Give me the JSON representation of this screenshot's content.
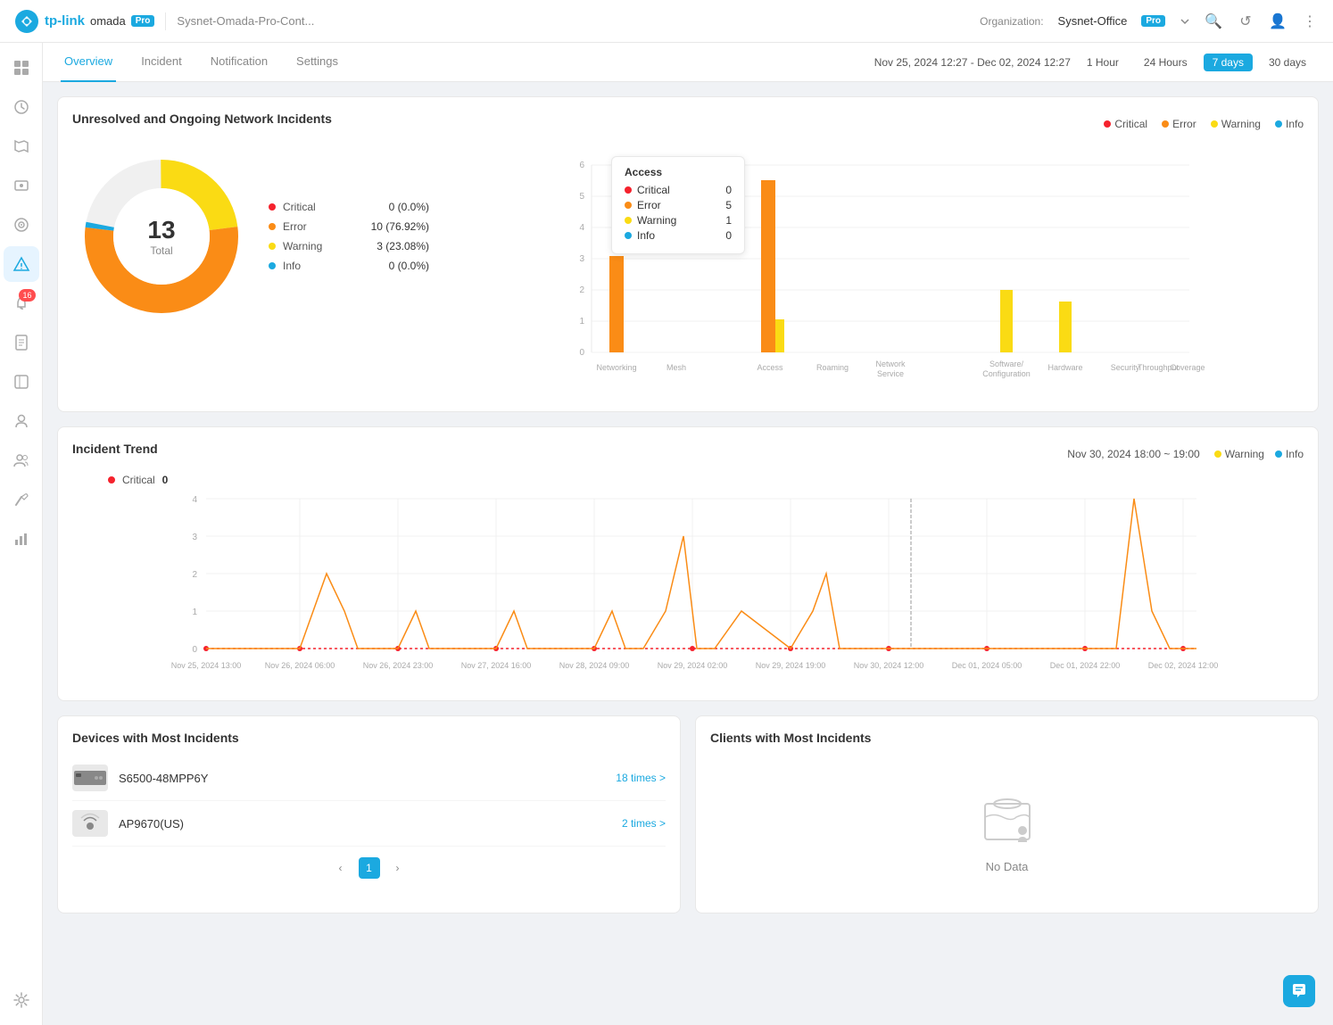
{
  "topbar": {
    "logo_tp": "tp-link",
    "logo_omada": "omada",
    "logo_pro": "Pro",
    "title": "Sysnet-Omada-Pro-Cont...",
    "org_label": "Organization:",
    "org_name": "Sysnet-Office",
    "org_pro": "Pro",
    "icons": [
      "search",
      "refresh",
      "user",
      "more"
    ]
  },
  "tabs": {
    "items": [
      "Overview",
      "Incident",
      "Notification",
      "Settings"
    ],
    "active": "Overview",
    "date_range": "Nov 25, 2024 12:27 - Dec 02, 2024 12:27",
    "time_filters": [
      "1 Hour",
      "24 Hours",
      "7 days",
      "30 days"
    ],
    "active_time": "7 days"
  },
  "sidebar": {
    "items": [
      {
        "name": "dashboard",
        "icon": "⊞",
        "active": false
      },
      {
        "name": "clock",
        "icon": "○",
        "active": false
      },
      {
        "name": "map",
        "icon": "◻",
        "active": false
      },
      {
        "name": "box",
        "icon": "⬜",
        "active": false
      },
      {
        "name": "target",
        "icon": "◎",
        "active": false
      },
      {
        "name": "incidents",
        "icon": "⚡",
        "active": true,
        "badge": null
      },
      {
        "name": "reports-badge",
        "icon": "📋",
        "active": false,
        "badge": "16"
      },
      {
        "name": "clipboard",
        "icon": "📄",
        "active": false
      },
      {
        "name": "briefcase",
        "icon": "💼",
        "active": false
      },
      {
        "name": "users",
        "icon": "👤",
        "active": false
      },
      {
        "name": "users2",
        "icon": "👥",
        "active": false
      },
      {
        "name": "tools",
        "icon": "🔧",
        "active": false
      },
      {
        "name": "chart",
        "icon": "📊",
        "active": false
      }
    ],
    "bottom": {
      "name": "settings",
      "icon": "⚙"
    }
  },
  "incidents_chart": {
    "title": "Unresolved and Ongoing Network Incidents",
    "legend": [
      {
        "name": "Critical",
        "color": "#f5222d"
      },
      {
        "name": "Error",
        "color": "#fa8c16"
      },
      {
        "name": "Warning",
        "color": "#fadb14"
      },
      {
        "name": "Info",
        "color": "#1ba9e0"
      }
    ],
    "donut": {
      "total": 13,
      "total_label": "Total",
      "segments": [
        {
          "name": "Critical",
          "value": 0,
          "pct": "0.0%",
          "color": "#f5222d",
          "angle": 0
        },
        {
          "name": "Error",
          "value": 10,
          "pct": "76.92%",
          "color": "#fa8c16",
          "angle": 277
        },
        {
          "name": "Warning",
          "value": 3,
          "pct": "23.08%",
          "color": "#fadb14",
          "angle": 83
        },
        {
          "name": "Info",
          "value": 0,
          "pct": "0.0%",
          "color": "#1ba9e0",
          "angle": 0
        }
      ],
      "stats": [
        {
          "name": "Critical",
          "value": "0 (0.0%)",
          "color": "#f5222d"
        },
        {
          "name": "Error",
          "value": "10 (76.92%)",
          "color": "#fa8c16"
        },
        {
          "name": "Warning",
          "value": "3 (23.08%)",
          "color": "#fadb14"
        },
        {
          "name": "Info",
          "value": "0 (0.0%)",
          "color": "#1ba9e0"
        }
      ]
    },
    "bar_chart": {
      "categories": [
        "Networking",
        "Mesh",
        "Access",
        "Roaming",
        "Network\nService",
        "Software/\nConfiguration",
        "Hardware",
        "Security",
        "Throughput",
        "Coverage"
      ],
      "y_max": 6,
      "y_ticks": [
        0,
        1,
        2,
        3,
        4,
        5,
        6
      ],
      "tooltip": {
        "title": "Access",
        "items": [
          {
            "name": "Critical",
            "value": 0,
            "color": "#f5222d"
          },
          {
            "name": "Error",
            "value": 5,
            "color": "#fa8c16"
          },
          {
            "name": "Warning",
            "value": 1,
            "color": "#fadb14"
          },
          {
            "name": "Info",
            "value": 0,
            "color": "#1ba9e0"
          }
        ]
      },
      "bars": [
        {
          "cat": "Networking",
          "error": 2.8,
          "warning": 0,
          "critical": 0
        },
        {
          "cat": "Mesh",
          "error": 0,
          "warning": 0,
          "critical": 0
        },
        {
          "cat": "Access",
          "error": 5,
          "warning": 1,
          "critical": 0
        },
        {
          "cat": "Roaming",
          "error": 0,
          "warning": 0,
          "critical": 0
        },
        {
          "cat": "Network Service",
          "error": 0,
          "warning": 0,
          "critical": 0
        },
        {
          "cat": "Software/Configuration",
          "error": 0,
          "warning": 2,
          "critical": 0
        },
        {
          "cat": "Hardware",
          "error": 0,
          "warning": 1.5,
          "critical": 0
        },
        {
          "cat": "Security",
          "error": 0,
          "warning": 0,
          "critical": 0
        },
        {
          "cat": "Throughput",
          "error": 0,
          "warning": 0,
          "critical": 0
        },
        {
          "cat": "Coverage",
          "error": 0,
          "warning": 0,
          "critical": 0
        }
      ]
    }
  },
  "trend_chart": {
    "title": "Incident Trend",
    "hover_time": "Nov 30, 2024 18:00 ~ 19:00",
    "legend": [
      {
        "name": "Warning",
        "color": "#fadb14"
      },
      {
        "name": "Info",
        "color": "#1ba9e0"
      }
    ],
    "hover_stats": [
      {
        "name": "Critical",
        "value": 0,
        "color": "#f5222d"
      }
    ],
    "x_labels": [
      "Nov 25, 2024 13:00",
      "Nov 26, 2024 06:00",
      "Nov 26, 2024 23:00",
      "Nov 27, 2024 16:00",
      "Nov 28, 2024 09:00",
      "Nov 29, 2024 02:00",
      "Nov 29, 2024 19:00",
      "Nov 30, 2024 12:00",
      "Dec 01, 2024 05:00",
      "Dec 01, 2024 22:00",
      "Dec 02, 2024 12:00"
    ],
    "y_ticks": [
      0,
      1,
      2,
      3,
      4
    ]
  },
  "devices": {
    "title": "Devices with Most Incidents",
    "items": [
      {
        "name": "S6500-48MPP6Y",
        "count": "18 times >",
        "icon": "switch"
      },
      {
        "name": "AP9670(US)",
        "count": "2 times >",
        "icon": "ap"
      }
    ],
    "pagination": {
      "current": 1,
      "total": 1
    }
  },
  "clients": {
    "title": "Clients with Most Incidents",
    "no_data": "No Data"
  }
}
